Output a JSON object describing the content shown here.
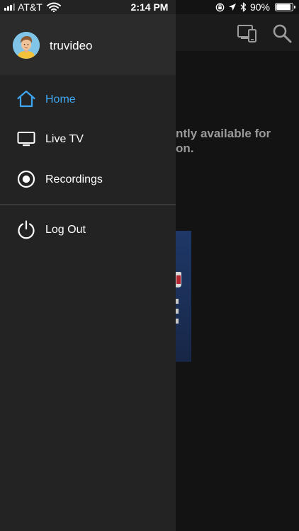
{
  "status_bar": {
    "carrier": "AT&T",
    "time": "2:14 PM",
    "battery_percent": "90%",
    "battery_level": 0.9
  },
  "background": {
    "message": "ntly available for\non.",
    "icons": [
      "devices-icon",
      "search-icon"
    ]
  },
  "drawer": {
    "username": "truvideo",
    "items": [
      {
        "label": "Home",
        "icon": "home-icon",
        "active": true
      },
      {
        "label": "Live TV",
        "icon": "tv-icon",
        "active": false
      },
      {
        "label": "Recordings",
        "icon": "record-icon",
        "active": false
      },
      {
        "label": "Log Out",
        "icon": "power-icon",
        "active": false
      }
    ]
  },
  "colors": {
    "accent": "#3ea5f0",
    "drawer_bg": "#232323",
    "drawer_header_bg": "#2b2b2b",
    "app_bg": "#131313"
  }
}
